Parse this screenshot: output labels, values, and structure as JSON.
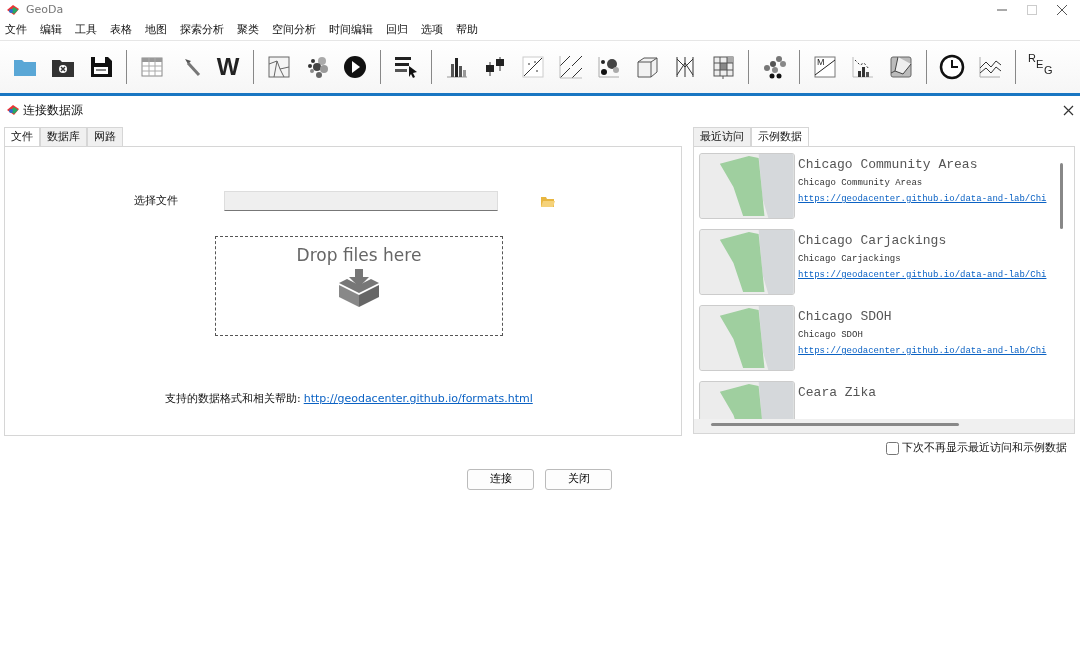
{
  "window": {
    "title": "GeoDa"
  },
  "menu": [
    "文件",
    "编辑",
    "工具",
    "表格",
    "地图",
    "探索分析",
    "聚类",
    "空间分析",
    "时间编辑",
    "回归",
    "选项",
    "帮助"
  ],
  "toolbar": {
    "weights_label": "W",
    "moran_label": "M",
    "regression_label": "REG"
  },
  "dialog": {
    "title": "连接数据源",
    "tabs": [
      {
        "label": "文件",
        "selected": true
      },
      {
        "label": "数据库",
        "selected": false
      },
      {
        "label": "网路",
        "selected": false
      }
    ],
    "file_label": "选择文件",
    "drop_text": "Drop files here",
    "help_label": "支持的数据格式和相关帮助:",
    "help_link": "http://geodacenter.github.io/formats.html",
    "side_tabs": [
      {
        "label": "最近访问",
        "selected": false
      },
      {
        "label": "示例数据",
        "selected": true
      }
    ],
    "samples": [
      {
        "title": "Chicago Community Areas",
        "subtitle": "Chicago Community Areas",
        "url": "https://geodacenter.github.io/data-and-lab/Chi"
      },
      {
        "title": "Chicago Carjackings",
        "subtitle": "Chicago Carjackings",
        "url": "https://geodacenter.github.io/data-and-lab/Chi"
      },
      {
        "title": "Chicago SDOH",
        "subtitle": "Chicago SDOH",
        "url": "https://geodacenter.github.io/data-and-lab/Chi"
      },
      {
        "title": "Ceara Zika"
      }
    ],
    "checkbox": {
      "label": "下次不再显示最近访问和示例数据",
      "checked": false
    },
    "buttons": [
      "连接",
      "关闭"
    ]
  }
}
